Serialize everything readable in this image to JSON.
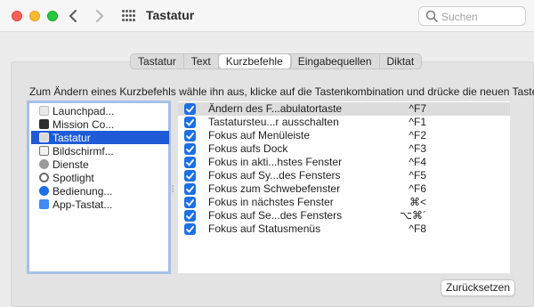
{
  "window": {
    "title": "Tastatur"
  },
  "search": {
    "placeholder": "Suchen"
  },
  "tabs": [
    {
      "label": "Tastatur",
      "active": false
    },
    {
      "label": "Text",
      "active": false
    },
    {
      "label": "Kurzbefehle",
      "active": true
    },
    {
      "label": "Eingabequellen",
      "active": false
    },
    {
      "label": "Diktat",
      "active": false
    }
  ],
  "instruction": "Zum Ändern eines Kurzbefehls wähle ihn aus, klicke auf die Tastenkombination und drücke die neuen Tasten.",
  "categories": [
    {
      "label": "Launchpad...",
      "icon": "launchpad-icon",
      "selected": false
    },
    {
      "label": "Mission Co...",
      "icon": "mission-control-icon",
      "selected": false
    },
    {
      "label": "Tastatur",
      "icon": "keyboard-icon",
      "selected": true
    },
    {
      "label": "Bildschirmf...",
      "icon": "screenshot-icon",
      "selected": false
    },
    {
      "label": "Dienste",
      "icon": "gear-icon",
      "selected": false
    },
    {
      "label": "Spotlight",
      "icon": "spotlight-icon",
      "selected": false
    },
    {
      "label": "Bedienung...",
      "icon": "accessibility-icon",
      "selected": false
    },
    {
      "label": "App-Tastat...",
      "icon": "app-shortcuts-icon",
      "selected": false
    }
  ],
  "shortcuts": [
    {
      "label": "Ändern des F...abulatortaste",
      "shortcut": "^F7",
      "checked": true
    },
    {
      "label": "Tastatursteu...r ausschalten",
      "shortcut": "^F1",
      "checked": true
    },
    {
      "label": "Fokus auf Menüleiste",
      "shortcut": "^F2",
      "checked": true
    },
    {
      "label": "Fokus aufs Dock",
      "shortcut": "^F3",
      "checked": true
    },
    {
      "label": "Fokus in akti...hstes Fenster",
      "shortcut": "^F4",
      "checked": true
    },
    {
      "label": "Fokus auf Sy...des Fensters",
      "shortcut": "^F5",
      "checked": true
    },
    {
      "label": "Fokus zum Schwebefenster",
      "shortcut": "^F6",
      "checked": true
    },
    {
      "label": "Fokus in nächstes Fenster",
      "shortcut": "⌘<",
      "checked": true
    },
    {
      "label": "Fokus auf Se...des Fensters",
      "shortcut": "⌥⌘´",
      "checked": true
    },
    {
      "label": "Fokus auf Statusmenüs",
      "shortcut": "^F8",
      "checked": true
    }
  ],
  "reset_button": "Zurücksetzen",
  "colors": {
    "accent": "#1f5bd6",
    "checkbox": "#1f6fe5",
    "list_focus_border": "#a6bfe9"
  }
}
